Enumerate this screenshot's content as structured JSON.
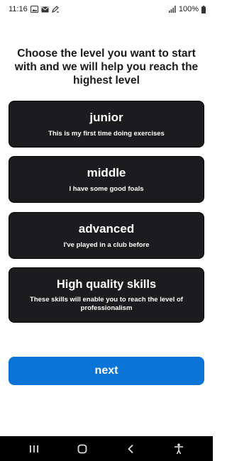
{
  "status_bar": {
    "time": "11:16",
    "battery": "100%",
    "icons": [
      "gallery-icon",
      "mail-icon",
      "edit-icon",
      "signal-icon",
      "battery-icon"
    ]
  },
  "heading": "Choose the level you want to start with and we will help you reach the highest level",
  "levels": [
    {
      "title": "junior",
      "description": "This is my first time doing exercises"
    },
    {
      "title": "middle",
      "description": "I have some good foals"
    },
    {
      "title": "advanced",
      "description": "I've played in a club before"
    },
    {
      "title": "High quality skills",
      "description": "These skills will enable you to reach the level of professionalism"
    }
  ],
  "next_label": "next",
  "nav_bar": {
    "icons": [
      "recent-apps-icon",
      "home-icon",
      "back-icon",
      "accessibility-icon"
    ]
  },
  "colors": {
    "card_background": "#1c1c1e",
    "accent": "#0a74d6",
    "nav_background": "#000000"
  }
}
